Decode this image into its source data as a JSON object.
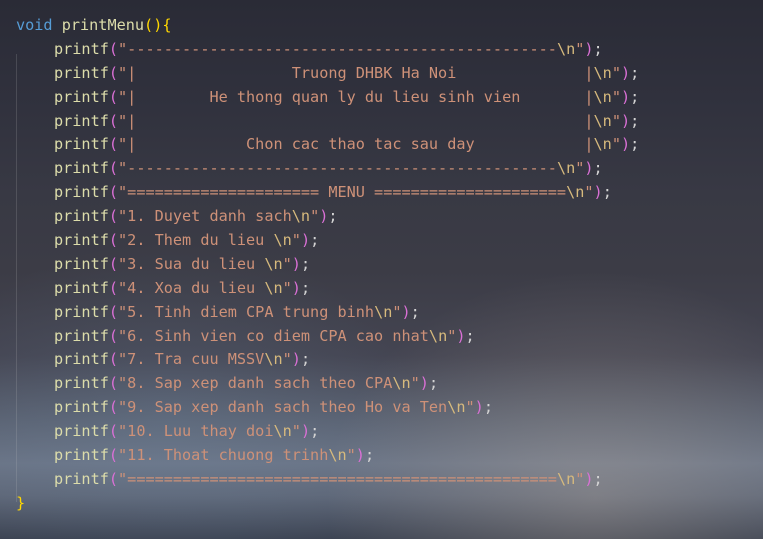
{
  "code": {
    "header": {
      "keyword": "void",
      "function_name": "printMenu",
      "open_paren": "(",
      "close_paren": ")",
      "open_brace": "{"
    },
    "call_name": "printf",
    "escape": "\\n",
    "lines": [
      {
        "text": "\"-----------------------------------------------",
        "suffix": "\""
      },
      {
        "text": "\"|                 Truong DHBK Ha Noi              |",
        "suffix": "\""
      },
      {
        "text": "\"|        He thong quan ly du lieu sinh vien       |",
        "suffix": "\""
      },
      {
        "text": "\"|                                                 |",
        "suffix": "\""
      },
      {
        "text": "\"|            Chon cac thao tac sau day            |",
        "suffix": "\""
      },
      {
        "text": "\"-----------------------------------------------",
        "suffix": "\""
      },
      {
        "text": "\"===================== MENU =====================",
        "suffix": "\""
      },
      {
        "text": "\"1. Duyet danh sach",
        "suffix": "\""
      },
      {
        "text": "\"2. Them du lieu ",
        "suffix": "\""
      },
      {
        "text": "\"3. Sua du lieu ",
        "suffix": "\""
      },
      {
        "text": "\"4. Xoa du lieu ",
        "suffix": "\""
      },
      {
        "text": "\"5. Tinh diem CPA trung binh",
        "suffix": "\""
      },
      {
        "text": "\"6. Sinh vien co diem CPA cao nhat",
        "suffix": "\""
      },
      {
        "text": "\"7. Tra cuu MSSV",
        "suffix": "\""
      },
      {
        "text": "\"8. Sap xep danh sach theo CPA",
        "suffix": "\""
      },
      {
        "text": "\"9. Sap xep danh sach theo Ho va Ten",
        "suffix": "\""
      },
      {
        "text": "\"10. Luu thay doi",
        "suffix": "\""
      },
      {
        "text": "\"11. Thoat chuong trinh",
        "suffix": "\""
      },
      {
        "text": "\"===============================================",
        "suffix": "\""
      }
    ],
    "close_brace": "}"
  }
}
